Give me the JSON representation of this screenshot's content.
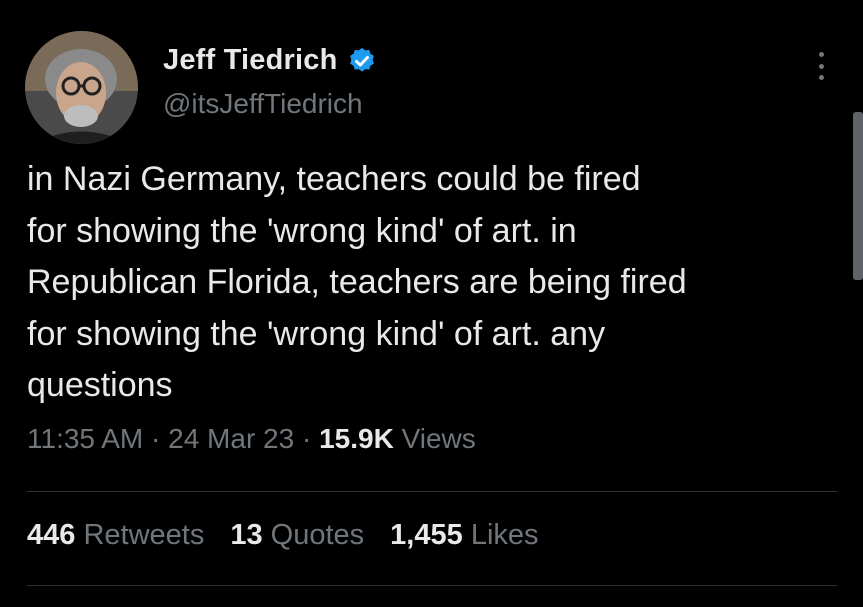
{
  "author": {
    "display_name": "Jeff Tiedrich",
    "handle": "@itsJeffTiedrich",
    "verified": true
  },
  "tweet": {
    "lines": [
      "in Nazi Germany, teachers could be fired",
      "for showing the 'wrong kind' of art. in",
      "Republican Florida, teachers are being fired",
      "for showing the 'wrong kind' of art. any",
      "questions"
    ],
    "time": "11:35 AM",
    "date": "24 Mar 23",
    "separator": "·",
    "views_count": "15.9K",
    "views_label": "Views"
  },
  "stats": {
    "retweets_count": "446",
    "retweets_label": "Retweets",
    "quotes_count": "13",
    "quotes_label": "Quotes",
    "likes_count": "1,455",
    "likes_label": "Likes"
  },
  "icons": {
    "verified_badge": "verified-check-icon",
    "more": "more-options-icon"
  },
  "colors": {
    "background": "#000000",
    "primary_text": "#e7e9ea",
    "secondary_text": "#71767b",
    "verified_blue": "#1d9bf0",
    "divider": "#2f3336"
  }
}
